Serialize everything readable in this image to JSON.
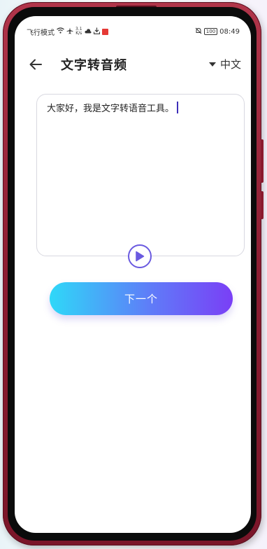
{
  "status_bar": {
    "mode_label": "飞行模式",
    "network_speed_value": "3.1",
    "network_speed_unit": "K/s",
    "battery": "100",
    "time": "08:49"
  },
  "header": {
    "title": "文字转音频",
    "language": "中文"
  },
  "editor": {
    "text": "大家好，我是文字转语音工具。"
  },
  "actions": {
    "next_label": "下一个"
  },
  "colors": {
    "accent_start": "#2fd8f8",
    "accent_end": "#7a3ff6",
    "play_icon": "#6a5ae0"
  }
}
